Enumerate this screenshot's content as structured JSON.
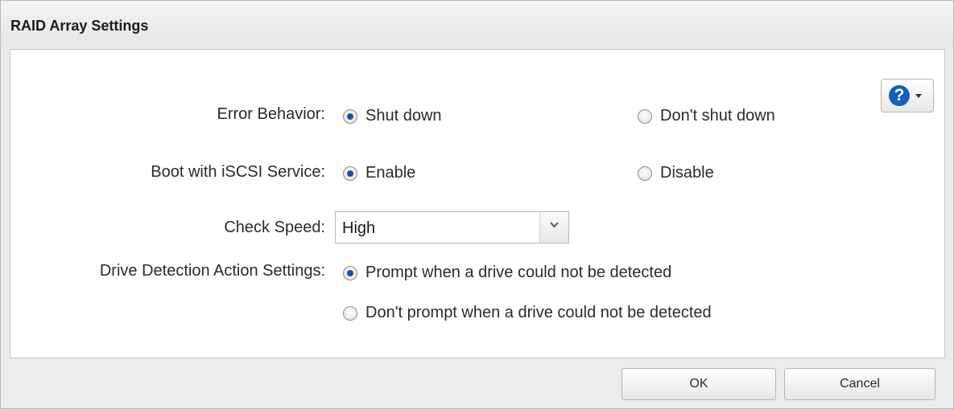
{
  "dialog": {
    "title": "RAID Array Settings"
  },
  "help": {
    "icon": "help-question-icon",
    "glyph": "?",
    "accent_color": "#1560b8"
  },
  "error_behavior": {
    "label": "Error Behavior:",
    "options": [
      "Shut down",
      "Don't shut down"
    ],
    "selected": "Shut down"
  },
  "boot_iscsi": {
    "label": "Boot with iSCSI Service:",
    "options": [
      "Enable",
      "Disable"
    ],
    "selected": "Enable"
  },
  "check_speed": {
    "label": "Check Speed:",
    "value": "High"
  },
  "drive_detection": {
    "label": "Drive Detection Action Settings:",
    "options": [
      "Prompt when a drive could not be detected",
      "Don't prompt when a drive could not be detected"
    ],
    "selected": "Prompt when a drive could not be detected"
  },
  "buttons": {
    "ok": "OK",
    "cancel": "Cancel"
  }
}
